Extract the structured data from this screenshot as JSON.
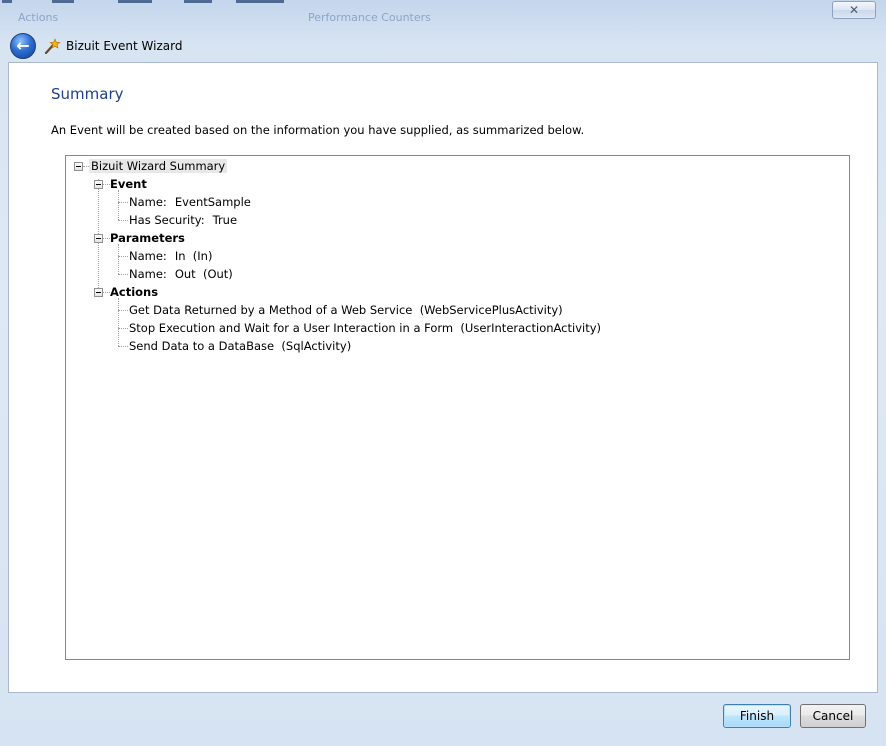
{
  "window": {
    "title": "Bizuit Event Wizard",
    "close_glyph": "✕",
    "back_glyph": "←",
    "background_ghost_text": [
      "Actions",
      "Performance Counters"
    ]
  },
  "page": {
    "heading": "Summary",
    "description": "An Event will be created based on the information you have supplied, as summarized below."
  },
  "tree": {
    "root": "Bizuit Wizard Summary",
    "event": {
      "label": "Event",
      "name_label": "Name:",
      "name_value": "EventSample",
      "security_label": "Has Security:",
      "security_value": "True"
    },
    "parameters": {
      "label": "Parameters",
      "items": [
        {
          "label": "Name:",
          "value": "In  (In)"
        },
        {
          "label": "Name:",
          "value": "Out  (Out)"
        }
      ]
    },
    "actions": {
      "label": "Actions",
      "items": [
        "Get Data Returned by a Method of a Web Service  (WebServicePlusActivity)",
        "Stop Execution and Wait for a User Interaction in a Form  (UserInteractionActivity)",
        "Send Data to a DataBase  (SqlActivity)"
      ]
    }
  },
  "buttons": {
    "finish": "Finish",
    "cancel": "Cancel"
  },
  "colors": {
    "heading": "#1e3f8a",
    "frame": "#d7e4f2",
    "default_button_border": "#3c7fb1"
  }
}
